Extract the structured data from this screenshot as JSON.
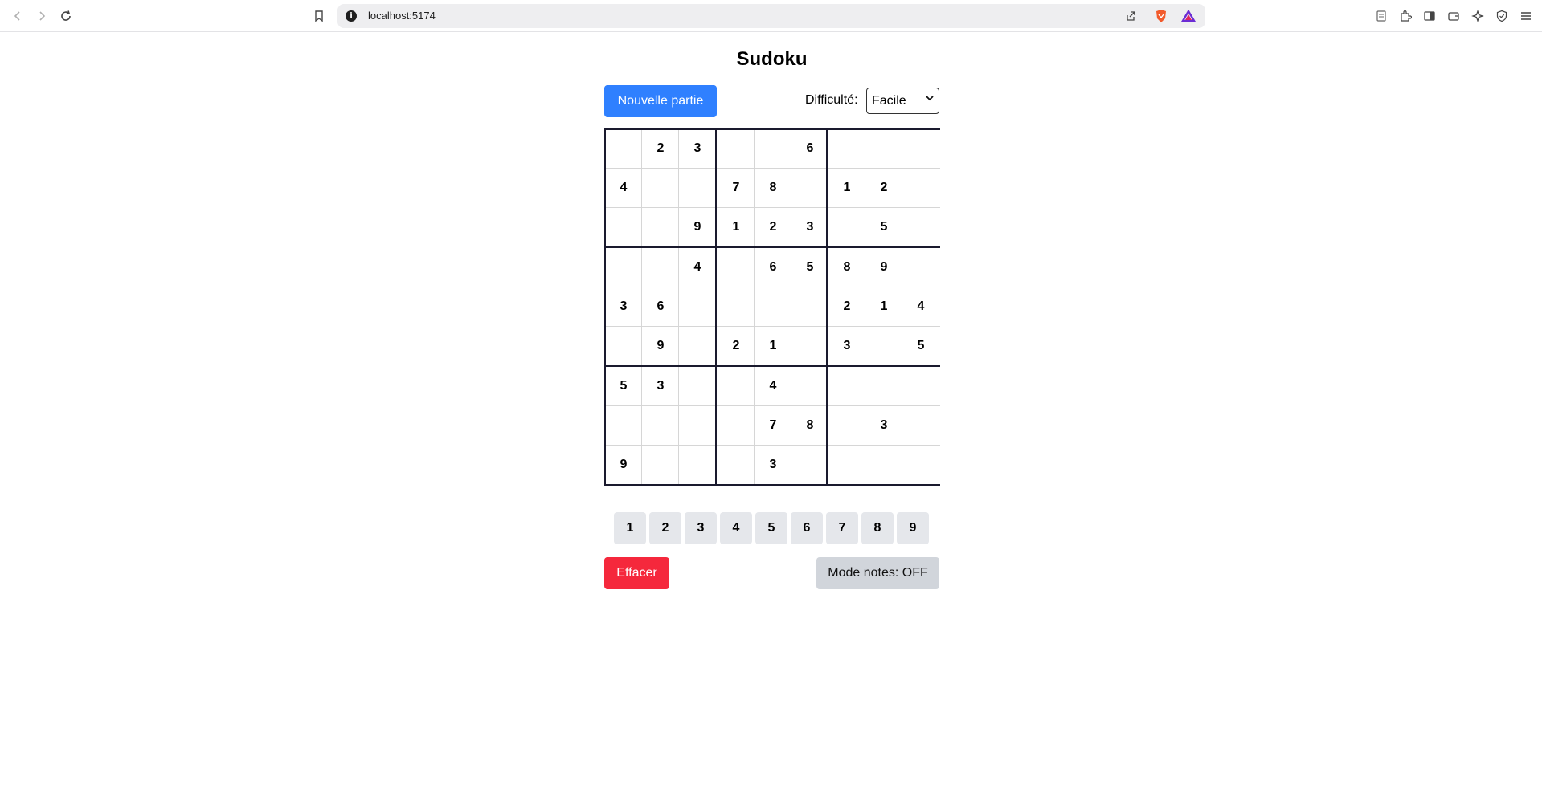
{
  "browser": {
    "url": "localhost:5174"
  },
  "app": {
    "title": "Sudoku",
    "new_game_label": "Nouvelle partie",
    "difficulty_label": "Difficulté:",
    "difficulty_selected": "Facile",
    "erase_label": "Effacer",
    "notes_label": "Mode notes: OFF",
    "numpad": [
      "1",
      "2",
      "3",
      "4",
      "5",
      "6",
      "7",
      "8",
      "9"
    ],
    "board": [
      [
        "",
        "2",
        "3",
        "",
        "",
        "6",
        "",
        "",
        ""
      ],
      [
        "4",
        "",
        "",
        "7",
        "8",
        "",
        "1",
        "2",
        ""
      ],
      [
        "",
        "",
        "9",
        "1",
        "2",
        "3",
        "",
        "5",
        ""
      ],
      [
        "",
        "",
        "4",
        "",
        "6",
        "5",
        "8",
        "9",
        ""
      ],
      [
        "3",
        "6",
        "",
        "",
        "",
        "",
        "2",
        "1",
        "4"
      ],
      [
        "",
        "9",
        "",
        "2",
        "1",
        "",
        "3",
        "",
        "5"
      ],
      [
        "5",
        "3",
        "",
        "",
        "4",
        "",
        "",
        "",
        ""
      ],
      [
        "",
        "",
        "",
        "",
        "7",
        "8",
        "",
        "3",
        ""
      ],
      [
        "9",
        "",
        "",
        "",
        "3",
        "",
        "",
        "",
        ""
      ]
    ]
  },
  "colors": {
    "primary": "#2f80ff",
    "danger": "#f5283c",
    "neutral": "#d1d5db",
    "numkey": "#e5e7eb"
  }
}
